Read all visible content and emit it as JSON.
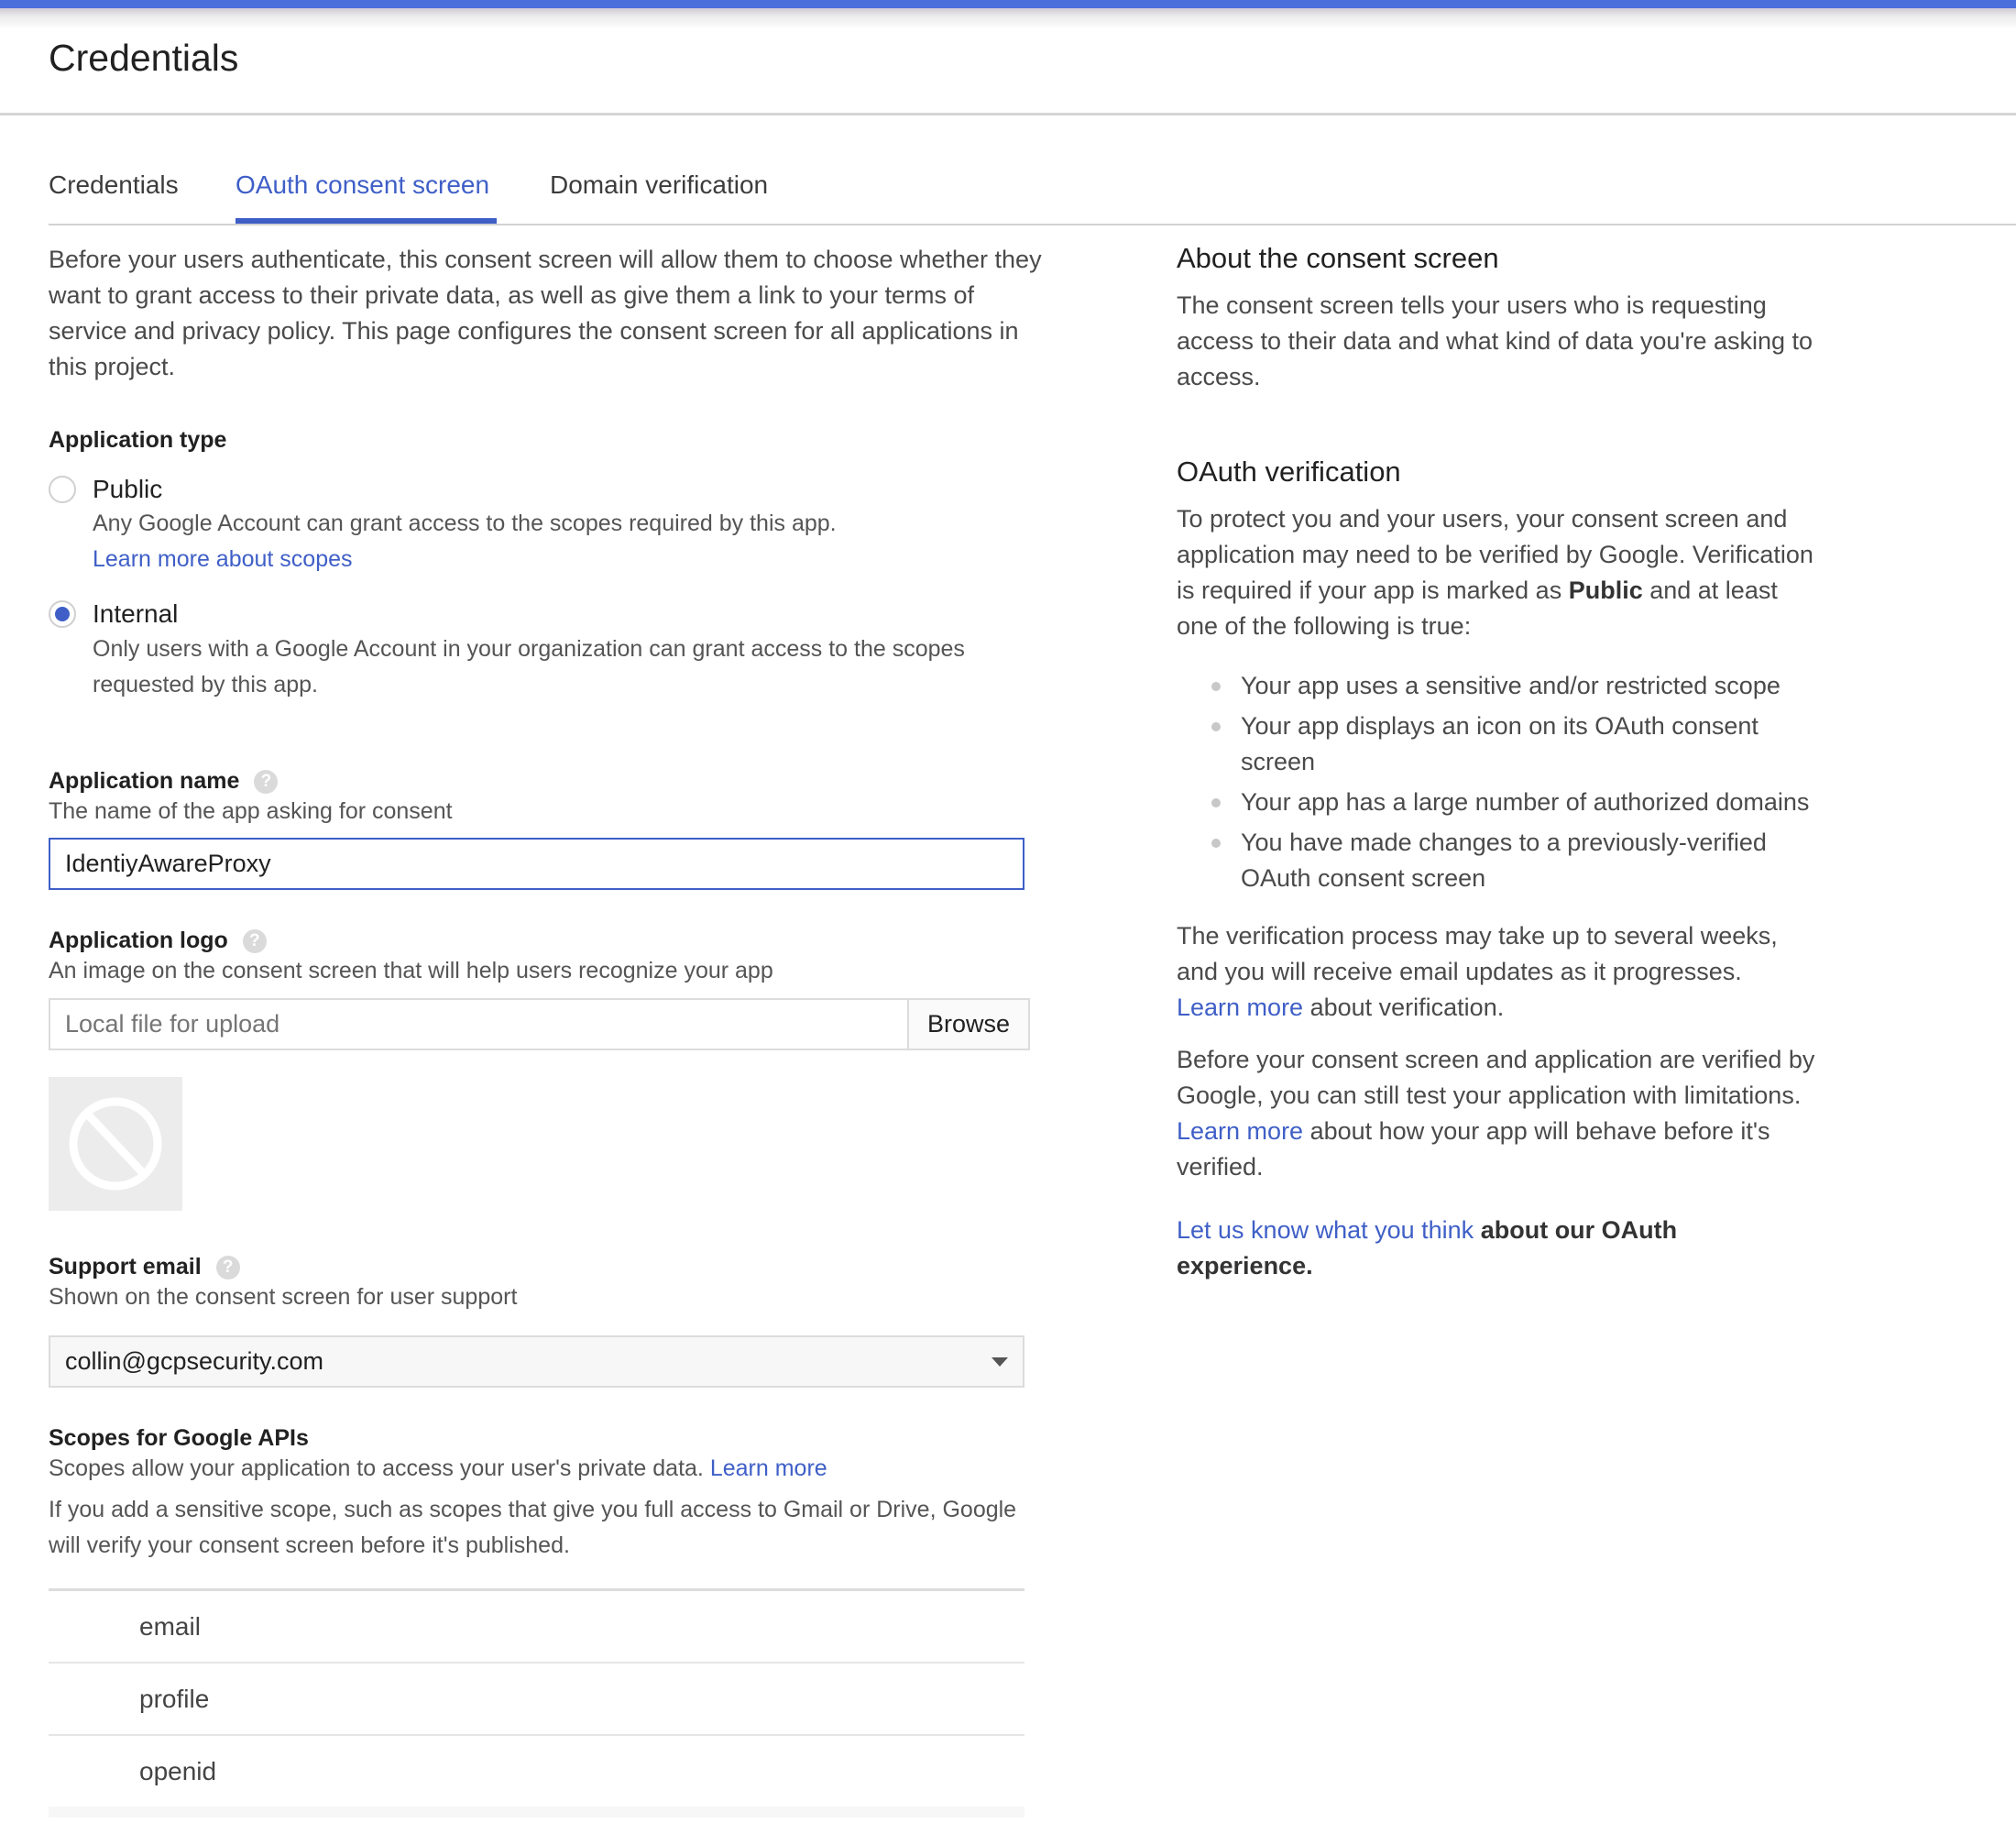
{
  "header": {
    "title": "Credentials",
    "accent_color": "#4a6fdc"
  },
  "tabs": [
    {
      "label": "Credentials",
      "active": false
    },
    {
      "label": "OAuth consent screen",
      "active": true
    },
    {
      "label": "Domain verification",
      "active": false
    }
  ],
  "intro": "Before your users authenticate, this consent screen will allow them to choose whether they want to grant access to their private data, as well as give them a link to your terms of service and privacy policy. This page configures the consent screen for all applications in this project.",
  "application_type": {
    "label": "Application type",
    "selected": "Internal",
    "options": [
      {
        "label": "Public",
        "description": "Any Google Account can grant access to the scopes required by this app.",
        "link": "Learn more about scopes",
        "checked": false
      },
      {
        "label": "Internal",
        "description": "Only users with a Google Account in your organization can grant access to the scopes requested by this app.",
        "checked": true
      }
    ]
  },
  "application_name": {
    "label": "Application name",
    "help_icon": "help-circle-icon",
    "description": "The name of the app asking for consent",
    "value": "IdentiyAwareProxy"
  },
  "application_logo": {
    "label": "Application logo",
    "help_icon": "help-circle-icon",
    "description": "An image on the consent screen that will help users recognize your app",
    "placeholder": "Local file for upload",
    "browse_label": "Browse",
    "preview_icon": "no-image-icon"
  },
  "support_email": {
    "label": "Support email",
    "help_icon": "help-circle-icon",
    "description": "Shown on the consent screen for user support",
    "selected": "collin@gcpsecurity.com"
  },
  "scopes": {
    "label": "Scopes for Google APIs",
    "description": "Scopes allow your application to access your user's private data.",
    "learn_more": "Learn more",
    "note": "If you add a sensitive scope, such as scopes that give you full access to Gmail or Drive, Google will verify your consent screen before it's published.",
    "items": [
      "email",
      "profile",
      "openid"
    ]
  },
  "sidebar": {
    "about_title": "About the consent screen",
    "about_text": "The consent screen tells your users who is requesting access to their data and what kind of data you're asking to access.",
    "verification_title": "OAuth verification",
    "verification_text_1": "To protect you and your users, your consent screen and application may need to be verified by Google. Verification is required if your app is marked as",
    "verification_bold": "Public",
    "verification_text_2": "and at least one of the following is true:",
    "bullets": [
      "Your app uses a sensitive and/or restricted scope",
      "Your app displays an icon on its OAuth consent screen",
      "Your app has a large number of authorized domains",
      "You have made changes to a previously-verified OAuth consent screen"
    ],
    "process_text_1": "The verification process may take up to several weeks, and you will receive email updates as it progresses.",
    "process_link": "Learn more",
    "process_text_2": "about verification.",
    "test_text_1": "Before your consent screen and application are verified by Google, you can still test your application with limitations.",
    "test_link": "Learn more",
    "test_text_2": "about how your app will behave before it's verified.",
    "feedback_link": "Let us know what you think",
    "feedback_text": "about our OAuth experience."
  }
}
